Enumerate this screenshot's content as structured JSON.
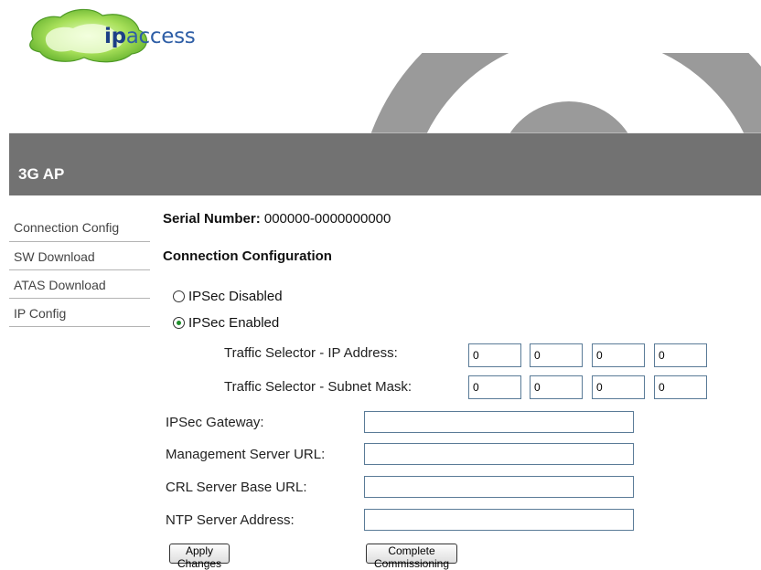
{
  "logo": {
    "brand_bold": "ip",
    "brand_rest": "access"
  },
  "header": {
    "title": "3G AP"
  },
  "sidebar": {
    "items": [
      {
        "label": "Connection Config"
      },
      {
        "label": "SW Download"
      },
      {
        "label": "ATAS Download"
      },
      {
        "label": "IP Config"
      }
    ]
  },
  "main": {
    "serial_label": "Serial Number:",
    "serial_value": "000000-0000000000",
    "section_title": "Connection Configuration",
    "ipsec_options": [
      {
        "label": "IPSec Disabled",
        "selected": false
      },
      {
        "label": "IPSec Enabled",
        "selected": true
      }
    ],
    "traffic_ip": {
      "label": "Traffic Selector - IP Address:",
      "octets": [
        "0",
        "0",
        "0",
        "0"
      ]
    },
    "traffic_mask": {
      "label": "Traffic Selector - Subnet Mask:",
      "octets": [
        "0",
        "0",
        "0",
        "0"
      ]
    },
    "fields": [
      {
        "label": "IPSec Gateway:",
        "value": ""
      },
      {
        "label": "Management Server URL:",
        "value": ""
      },
      {
        "label": "CRL Server Base URL:",
        "value": ""
      },
      {
        "label": "NTP Server Address:",
        "value": ""
      }
    ],
    "buttons": {
      "apply": "Apply Changes",
      "complete": "Complete Commissioning"
    }
  },
  "colors": {
    "header_bg": "#727272",
    "logo_green": "#7ac943",
    "logo_blue": "#2e5ea6",
    "radio_dot": "#1f8f2c",
    "input_border": "#5a7b97"
  }
}
